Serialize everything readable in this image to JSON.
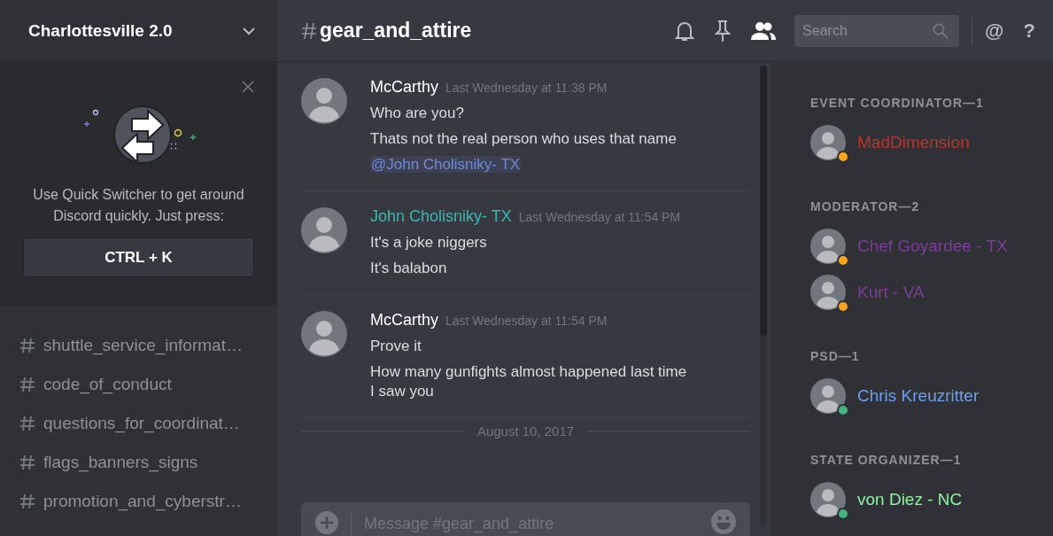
{
  "server": {
    "name": "Charlottesville 2.0"
  },
  "quick_switcher": {
    "message": "Use Quick Switcher to get around Discord quickly. Just press:",
    "shortcut": "CTRL + K"
  },
  "channels": [
    {
      "name": "shuttle_service_informat…"
    },
    {
      "name": "code_of_conduct"
    },
    {
      "name": "questions_for_coordinat…"
    },
    {
      "name": "flags_banners_signs"
    },
    {
      "name": "promotion_and_cyberstr…"
    }
  ],
  "channel_header": {
    "name": "gear_and_attire",
    "search_placeholder": "Search",
    "members_toggle": {
      "on": true
    },
    "mention_glyph": "@",
    "help_glyph": "?"
  },
  "messages": [
    {
      "author": "McCarthy",
      "color": "#ffffff",
      "timestamp": "Last Wednesday at 11:38 PM",
      "lines": [
        {
          "kind": "text",
          "text": "Who are you?"
        },
        {
          "kind": "text",
          "text": "Thats not the real person who uses that name"
        },
        {
          "kind": "mention",
          "text": "@John Cholisniky- TX"
        }
      ]
    },
    {
      "author": "John Cholisniky- TX",
      "color": "#3fb5b0",
      "timestamp": "Last Wednesday at 11:54 PM",
      "lines": [
        {
          "kind": "text",
          "text": "It's a joke niggers"
        },
        {
          "kind": "text",
          "text": "It's balabon"
        }
      ]
    },
    {
      "author": "McCarthy",
      "color": "#ffffff",
      "timestamp": "Last Wednesday at 11:54 PM",
      "lines": [
        {
          "kind": "text",
          "text": "Prove it"
        },
        {
          "kind": "text",
          "text": "How many gunfights almost happened last time I saw you"
        }
      ]
    }
  ],
  "date_divider": "August 10, 2017",
  "composer": {
    "placeholder": "Message #gear_and_attire"
  },
  "member_groups": [
    {
      "title": "EVENT COORDINATOR—1",
      "members": [
        {
          "name": "MadDimension",
          "color": "#b8362a",
          "status": {
            "color": "#faa61a"
          }
        }
      ]
    },
    {
      "title": "MODERATOR—2",
      "members": [
        {
          "name": "Chef Goyardee - TX",
          "color": "#7d3c98",
          "status": {
            "color": "#faa61a"
          }
        },
        {
          "name": "Kurt - VA",
          "color": "#7d3c98",
          "status": {
            "color": "#faa61a"
          }
        }
      ]
    },
    {
      "title": "PSD—1",
      "members": [
        {
          "name": "Chris Kreuzritter",
          "color": "#6f9ff0",
          "status": {
            "color": "#43b581"
          }
        }
      ]
    },
    {
      "title": "STATE ORGANIZER—1",
      "members": [
        {
          "name": "von Diez - NC",
          "color": "#8ef0a0",
          "status": {
            "color": "#43b581"
          }
        }
      ]
    }
  ]
}
